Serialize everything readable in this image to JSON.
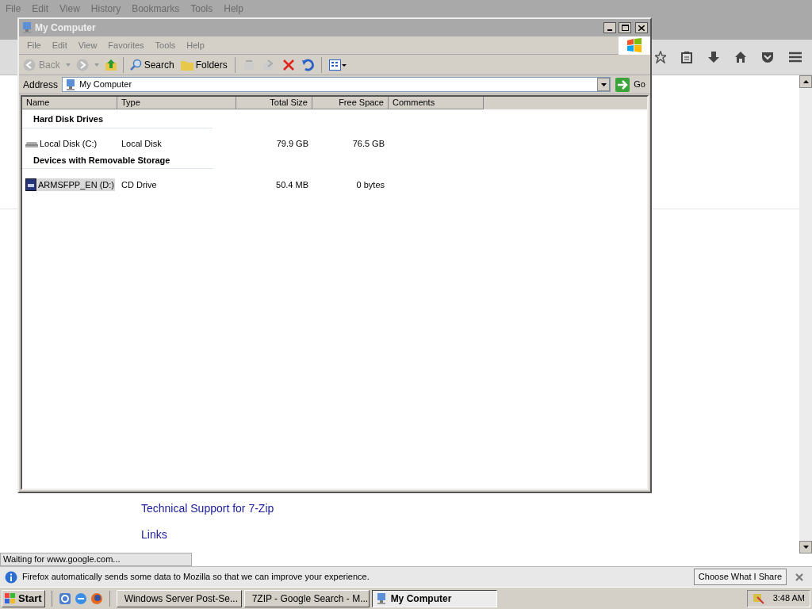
{
  "browser": {
    "menu": [
      "File",
      "Edit",
      "View",
      "History",
      "Bookmarks",
      "Tools",
      "Help"
    ],
    "page_links": [
      "Technical Support for 7-Zip",
      "Links"
    ],
    "status": "Waiting for www.google.com...",
    "notification": {
      "text": "Firefox automatically sends some data to Mozilla so that we can improve your experience.",
      "button": "Choose What I Share"
    }
  },
  "explorer": {
    "title": "My Computer",
    "menu": [
      "File",
      "Edit",
      "View",
      "Favorites",
      "Tools",
      "Help"
    ],
    "toolbar": {
      "back": "Back",
      "search": "Search",
      "folders": "Folders"
    },
    "address": {
      "label": "Address",
      "value": "My Computer",
      "go": "Go"
    },
    "columns": [
      "Name",
      "Type",
      "Total Size",
      "Free Space",
      "Comments"
    ],
    "groups": [
      {
        "title": "Hard Disk Drives",
        "items": [
          {
            "kind": "disk",
            "name": "Local Disk (C:)",
            "type": "Local Disk",
            "total": "79.9 GB",
            "free": "76.5 GB",
            "selected": false
          }
        ]
      },
      {
        "title": "Devices with Removable Storage",
        "items": [
          {
            "kind": "cd",
            "name": "ARMSFPP_EN (D:)",
            "type": "CD Drive",
            "total": "50.4 MB",
            "free": "0 bytes",
            "selected": true
          }
        ]
      }
    ]
  },
  "taskbar": {
    "start": "Start",
    "tasks": [
      {
        "kind": "server",
        "label": "Windows Server Post-Se...",
        "selected": false
      },
      {
        "kind": "firefox",
        "label": "7ZIP - Google Search - M...",
        "selected": false
      },
      {
        "kind": "computer",
        "label": "My Computer",
        "selected": true
      }
    ],
    "clock": "3:48 AM"
  }
}
